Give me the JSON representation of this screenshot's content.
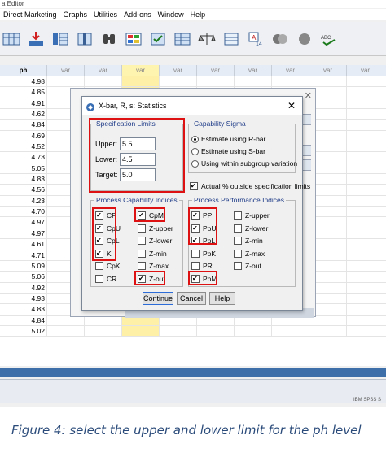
{
  "window": {
    "title_fragment": "a Editor"
  },
  "menu": [
    "Direct Marketing",
    "Graphs",
    "Utilities",
    "Add-ons",
    "Window",
    "Help"
  ],
  "grid": {
    "first_col_header": "ph",
    "var_header": "var",
    "values": [
      "4.98",
      "4.85",
      "4.91",
      "4.62",
      "4.84",
      "4.69",
      "4.52",
      "4.73",
      "5.05",
      "4.83",
      "4.56",
      "4.23",
      "4.70",
      "4.97",
      "4.97",
      "4.61",
      "4.71",
      "5.09",
      "5.06",
      "4.92",
      "4.93",
      "4.83",
      "4.84",
      "5.02"
    ]
  },
  "statusbar": {
    "text": "IBM SPSS S"
  },
  "dialog": {
    "title": "X-bar, R, s: Statistics",
    "spec_limits": {
      "legend": "Specification Limits",
      "upper_label": "Upper:",
      "upper_value": "5.5",
      "lower_label": "Lower:",
      "lower_value": "4.5",
      "target_label": "Target:",
      "target_value": "5.0"
    },
    "capability_sigma": {
      "legend": "Capability Sigma",
      "options": [
        "Estimate using R-bar",
        "Estimate using S-bar",
        "Using within subgroup variation"
      ],
      "selected": 0
    },
    "actual_pct": {
      "label": "Actual % outside specification limits",
      "checked": true
    },
    "pci": {
      "legend": "Process Capability Indices",
      "col1": [
        {
          "label": "CP",
          "checked": true
        },
        {
          "label": "CpU",
          "checked": true
        },
        {
          "label": "CpL",
          "checked": true
        },
        {
          "label": "K",
          "checked": true
        },
        {
          "label": "CpK",
          "checked": false
        },
        {
          "label": "CR",
          "checked": false
        }
      ],
      "col2": [
        {
          "label": "CpM",
          "checked": true
        },
        {
          "label": "Z-upper",
          "checked": false
        },
        {
          "label": "Z-lower",
          "checked": false
        },
        {
          "label": "Z-min",
          "checked": false
        },
        {
          "label": "Z-max",
          "checked": false
        },
        {
          "label": "Z-out",
          "checked": true
        }
      ]
    },
    "ppi": {
      "legend": "Process Performance Indices",
      "col1": [
        {
          "label": "PP",
          "checked": true
        },
        {
          "label": "PpU",
          "checked": true
        },
        {
          "label": "PpL",
          "checked": true
        },
        {
          "label": "PpK",
          "checked": false
        },
        {
          "label": "PR",
          "checked": false
        },
        {
          "label": "PpM",
          "checked": true
        }
      ],
      "col2": [
        {
          "label": "Z-upper",
          "checked": false
        },
        {
          "label": "Z-lower",
          "checked": false
        },
        {
          "label": "Z-min",
          "checked": false
        },
        {
          "label": "Z-max",
          "checked": false
        },
        {
          "label": "Z-out",
          "checked": false
        }
      ]
    },
    "buttons": {
      "continue": "Continue",
      "cancel": "Cancel",
      "help": "Help"
    }
  },
  "caption": "Figure 4: select the upper and lower limit for the ph level",
  "colors": {
    "highlight_red": "#d11111",
    "selected_column": "#fff0a8",
    "legend_blue": "#1f3c88"
  }
}
